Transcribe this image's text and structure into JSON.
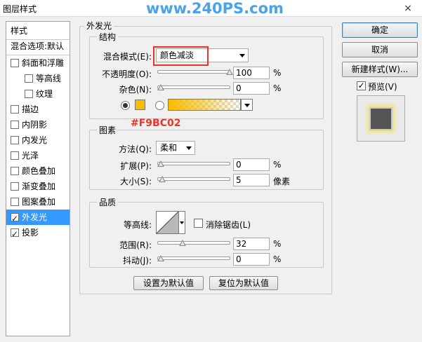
{
  "window": {
    "title": "图层样式",
    "watermark": "www.240PS.com",
    "close_icon": "×"
  },
  "sidebar": {
    "header": "样式",
    "blend_options": "混合选项:默认",
    "items": [
      {
        "label": "斜面和浮雕",
        "checked": false,
        "indent": false
      },
      {
        "label": "等高线",
        "checked": false,
        "indent": true
      },
      {
        "label": "纹理",
        "checked": false,
        "indent": true
      },
      {
        "label": "描边",
        "checked": false,
        "indent": false
      },
      {
        "label": "内阴影",
        "checked": false,
        "indent": false
      },
      {
        "label": "内发光",
        "checked": false,
        "indent": false
      },
      {
        "label": "光泽",
        "checked": false,
        "indent": false
      },
      {
        "label": "颜色叠加",
        "checked": false,
        "indent": false
      },
      {
        "label": "渐变叠加",
        "checked": false,
        "indent": false
      },
      {
        "label": "图案叠加",
        "checked": false,
        "indent": false
      },
      {
        "label": "外发光",
        "checked": true,
        "indent": false,
        "selected": true
      },
      {
        "label": "投影",
        "checked": true,
        "indent": false
      }
    ]
  },
  "outer_glow": {
    "title": "外发光",
    "structure": {
      "title": "结构",
      "blend_mode_label": "混合模式(E):",
      "blend_mode_value": "颜色减淡",
      "opacity_label": "不透明度(O):",
      "opacity_value": "100",
      "opacity_unit": "%",
      "noise_label": "杂色(N):",
      "noise_value": "0",
      "noise_unit": "%",
      "glow_color": "#f9bc02"
    },
    "annotation": "#F9BC02",
    "elements": {
      "title": "图素",
      "method_label": "方法(Q):",
      "method_value": "柔和",
      "spread_label": "扩展(P):",
      "spread_value": "0",
      "spread_unit": "%",
      "size_label": "大小(S):",
      "size_value": "5",
      "size_unit": "像素"
    },
    "quality": {
      "title": "品质",
      "contour_label": "等高线:",
      "antialias_label": "消除锯齿(L)",
      "antialias_checked": false,
      "range_label": "范围(R):",
      "range_value": "32",
      "range_unit": "%",
      "jitter_label": "抖动(J):",
      "jitter_value": "0",
      "jitter_unit": "%"
    },
    "make_default": "设置为默认值",
    "reset_default": "复位为默认值"
  },
  "buttons": {
    "ok": "确定",
    "cancel": "取消",
    "new_style": "新建样式(W)...",
    "preview_label": "预览(V)",
    "preview_checked": true
  },
  "colors": {
    "accent_selection": "#3399ff",
    "annotation_red": "#e8352a",
    "watermark_blue": "#4aa3e8"
  }
}
